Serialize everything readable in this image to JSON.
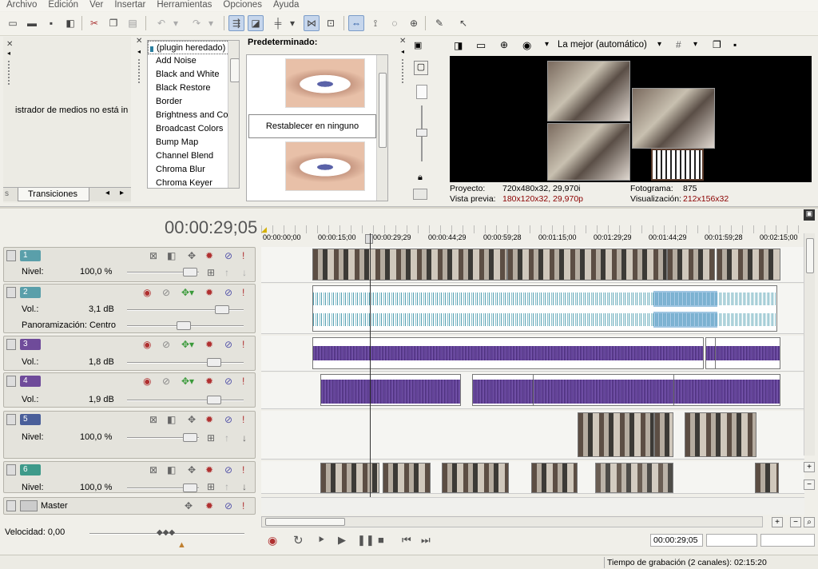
{
  "menu": [
    "Archivo",
    "Edición",
    "Ver",
    "Insertar",
    "Herramientas",
    "Opciones",
    "Ayuda"
  ],
  "media": {
    "message": "istrador de medios no está in",
    "tab_s": "s",
    "tab_label": "Transiciones"
  },
  "fx": {
    "items": [
      "(plugin heredado)",
      "Add Noise",
      "Black and White",
      "Black Restore",
      "Border",
      "Brightness and Co",
      "Broadcast Colors",
      "Bump Map",
      "Channel Blend",
      "Chroma Blur",
      "Chroma Keyer"
    ],
    "preset_title": "Predeterminado:",
    "preset_reset": "Restablecer en ninguno"
  },
  "preview": {
    "quality": "La mejor (automático)",
    "proj_label": "Proyecto:",
    "proj_value": "720x480x32, 29,970i",
    "prev_label": "Vista previa:",
    "prev_value": "180x120x32, 29,970p",
    "frame_label": "Fotograma:",
    "frame_value": "875",
    "disp_label": "Visualización:",
    "disp_value": "212x156x32",
    "accent": "#8b0000"
  },
  "timeline": {
    "timecode": "00:00:29;05",
    "ruler": [
      "00:00:00;00",
      "00:00:15;00",
      "00:00:29;29",
      "00:00:44;29",
      "00:00:59;28",
      "00:01:15;00",
      "00:01:29;29",
      "00:01:44;29",
      "00:01:59;28",
      "00:02:15;00"
    ]
  },
  "tracks": [
    {
      "num": "1",
      "type": "video",
      "color": "#5a9faa",
      "p1_label": "Nivel:",
      "p1_value": "100,0 %"
    },
    {
      "num": "2",
      "type": "audio",
      "color": "#5a9faa",
      "p1_label": "Vol.:",
      "p1_value": "3,1 dB",
      "p2_label": "Panoramización: Centro"
    },
    {
      "num": "3",
      "type": "audio",
      "color": "#6f4b9a",
      "p1_label": "Vol.:",
      "p1_value": "1,8 dB"
    },
    {
      "num": "4",
      "type": "audio",
      "color": "#6f4b9a",
      "p1_label": "Vol.:",
      "p1_value": "1,9 dB"
    },
    {
      "num": "5",
      "type": "video",
      "color": "#4a5f9a",
      "p1_label": "Nivel:",
      "p1_value": "100,0 %"
    },
    {
      "num": "6",
      "type": "video",
      "color": "#3e9a8a",
      "p1_label": "Nivel:",
      "p1_value": "100,0 %"
    }
  ],
  "master": {
    "label": "Master"
  },
  "transport": {
    "rate_label": "Velocidad: 0,00",
    "time": "00:00:29;05"
  },
  "status": {
    "record_time": "Tiempo de grabación (2 canales): 02:15:20"
  }
}
